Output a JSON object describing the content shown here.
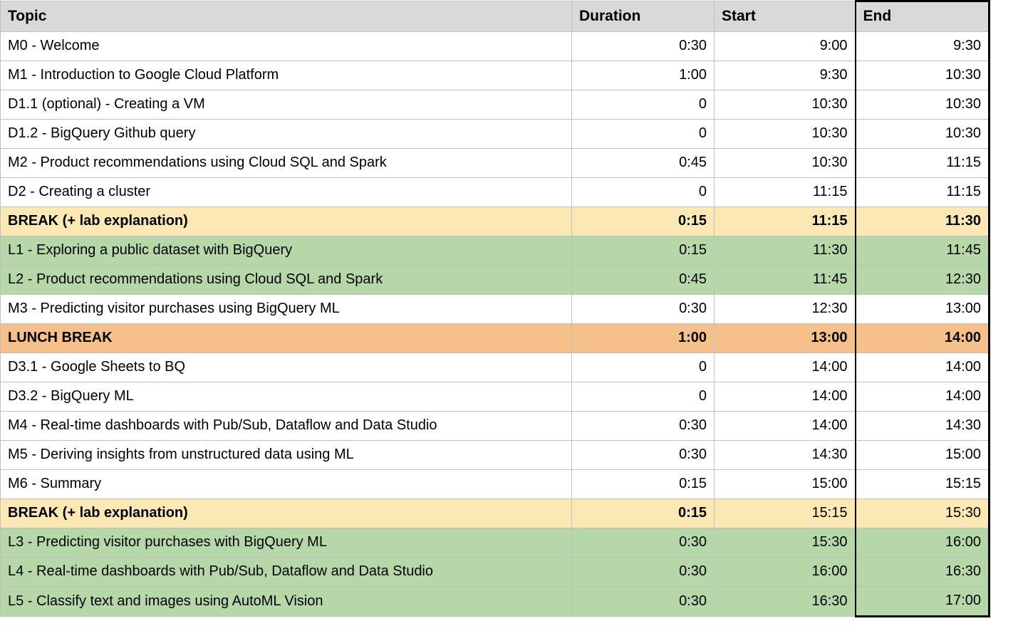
{
  "columns": {
    "topic": "Topic",
    "duration": "Duration",
    "start": "Start",
    "end": "End"
  },
  "rows": [
    {
      "style": "",
      "topic": "M0 - Welcome",
      "duration": "0:30",
      "start": "9:00",
      "end": "9:30"
    },
    {
      "style": "",
      "topic": "M1 - Introduction to Google Cloud Platform",
      "duration": "1:00",
      "start": "9:30",
      "end": "10:30"
    },
    {
      "style": "",
      "topic": "D1.1 (optional) - Creating a VM",
      "duration": "0",
      "start": "10:30",
      "end": "10:30"
    },
    {
      "style": "",
      "topic": "D1.2 - BigQuery Github query",
      "duration": "0",
      "start": "10:30",
      "end": "10:30"
    },
    {
      "style": "",
      "topic": "M2 - Product recommendations using Cloud SQL and Spark",
      "duration": "0:45",
      "start": "10:30",
      "end": "11:15"
    },
    {
      "style": "",
      "topic": "D2 - Creating a cluster",
      "duration": "0",
      "start": "11:15",
      "end": "11:15"
    },
    {
      "style": "break-yellow",
      "topic": "BREAK (+ lab explanation)",
      "duration": "0:15",
      "start": "11:15",
      "end": "11:30"
    },
    {
      "style": "lab",
      "topic": "L1 - Exploring a public dataset with BigQuery",
      "duration": "0:15",
      "start": "11:30",
      "end": "11:45"
    },
    {
      "style": "lab",
      "topic": "L2 - Product recommendations using Cloud SQL and Spark",
      "duration": "0:45",
      "start": "11:45",
      "end": "12:30"
    },
    {
      "style": "",
      "topic": "M3 - Predicting visitor purchases using BigQuery ML",
      "duration": "0:30",
      "start": "12:30",
      "end": "13:00"
    },
    {
      "style": "break-orange",
      "topic": "LUNCH BREAK",
      "duration": "1:00",
      "start": "13:00",
      "end": "14:00"
    },
    {
      "style": "",
      "topic": "D3.1 - Google Sheets to BQ",
      "duration": "0",
      "start": "14:00",
      "end": "14:00"
    },
    {
      "style": "",
      "topic": "D3.2 - BigQuery ML",
      "duration": "0",
      "start": "14:00",
      "end": "14:00"
    },
    {
      "style": "",
      "topic": "M4 - Real-time dashboards with Pub/Sub, Dataflow and Data Studio",
      "duration": "0:30",
      "start": "14:00",
      "end": "14:30"
    },
    {
      "style": "",
      "topic": "M5 - Deriving insights from unstructured data using ML",
      "duration": "0:30",
      "start": "14:30",
      "end": "15:00"
    },
    {
      "style": "",
      "topic": "M6 - Summary",
      "duration": "0:15",
      "start": "15:00",
      "end": "15:15"
    },
    {
      "style": "break-yellow partial-bold",
      "topic": "BREAK (+ lab explanation)",
      "duration": "0:15",
      "start": "15:15",
      "end": "15:30"
    },
    {
      "style": "lab",
      "topic": "L3 - Predicting visitor purchases with BigQuery ML",
      "duration": "0:30",
      "start": "15:30",
      "end": "16:00"
    },
    {
      "style": "lab",
      "topic": "L4 - Real-time dashboards with Pub/Sub, Dataflow and Data Studio",
      "duration": "0:30",
      "start": "16:00",
      "end": "16:30"
    },
    {
      "style": "lab",
      "topic": "L5 - Classify text and images using AutoML Vision",
      "duration": "0:30",
      "start": "16:30",
      "end": "17:00"
    }
  ]
}
